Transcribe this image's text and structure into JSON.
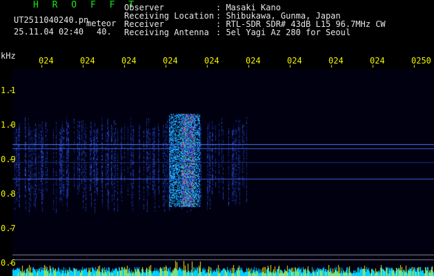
{
  "header": {
    "brand": "H R O F F T",
    "filename": "UT2511040240.pn",
    "meteor_label": "meteor",
    "datetime": "25.11.04 02:40",
    "count": "40.",
    "info": [
      {
        "label": "Observer",
        "value": ": Masaki Kano"
      },
      {
        "label": "Receiving Location",
        "value": ": Shibukawa, Gunma, Japan"
      },
      {
        "label": "Receiver",
        "value": ": RTL-SDR SDR# 43dB L15 96.7MHz CW"
      },
      {
        "label": "Receiving Antenna",
        "value": ": 5el Yagi Az 280 for Seoul"
      }
    ]
  },
  "spectrogram": {
    "unit_label": "kHz",
    "freq_ticks": [
      "1.1",
      "1.0",
      "0.9",
      "0.8",
      "0.7",
      "0.6"
    ],
    "time_ticks": [
      "024",
      "024",
      "024",
      "024",
      "024",
      "024",
      "024",
      "024",
      "024",
      "0250"
    ],
    "colors": {
      "background": "#000010",
      "signal_low": "#1b3cc8",
      "signal_high": "#ff2a7a",
      "grid": "#3060c0",
      "bar": "#ffee00",
      "noise": "#00d0ff"
    }
  }
}
